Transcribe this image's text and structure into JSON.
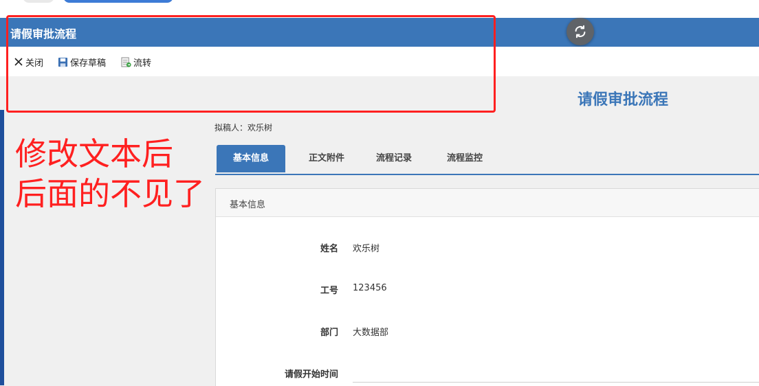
{
  "window": {
    "title": "请假审批流程"
  },
  "toolbar": {
    "close": {
      "label": "关闭",
      "icon": "close-icon"
    },
    "save_draft": {
      "label": "保存草稿",
      "icon": "floppy-disk-icon"
    },
    "forward": {
      "label": "流转",
      "icon": "forward-document-icon"
    }
  },
  "refresh": {
    "icon": "refresh-icon"
  },
  "form": {
    "heading": "请假审批流程",
    "drafter": "拟稿人：欢乐树"
  },
  "tabs": [
    {
      "label": "基本信息",
      "active": true
    },
    {
      "label": "正文附件",
      "active": false
    },
    {
      "label": "流程记录",
      "active": false
    },
    {
      "label": "流程监控",
      "active": false
    }
  ],
  "panel": {
    "title": "基本信息",
    "fields": [
      {
        "label": "姓名",
        "value": "欢乐树"
      },
      {
        "label": "工号",
        "value": "123456"
      },
      {
        "label": "部门",
        "value": "大数据部"
      },
      {
        "label": "请假开始时间",
        "value": ""
      }
    ]
  },
  "annotation": {
    "lines": [
      "修改文本后",
      "后面的不见了"
    ],
    "color": "#ff2020"
  },
  "colors": {
    "accent": "#3b76b8"
  }
}
